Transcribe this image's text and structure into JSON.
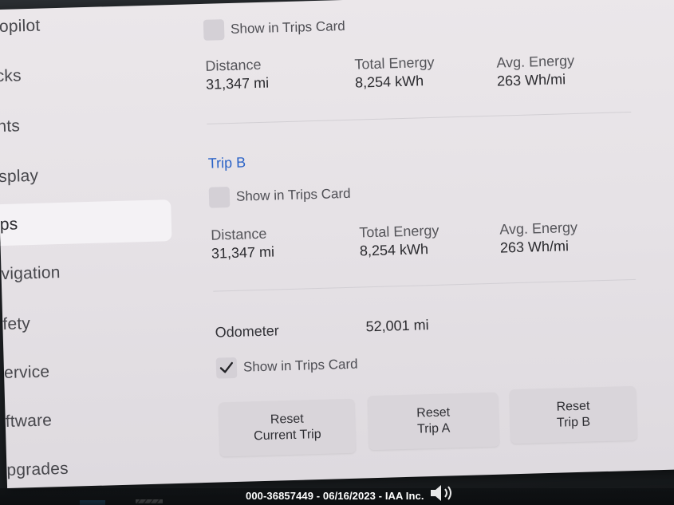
{
  "sidebar": {
    "items": [
      {
        "label": "topilot"
      },
      {
        "label": "cks"
      },
      {
        "label": "hts"
      },
      {
        "label": "splay"
      },
      {
        "label": "ps"
      },
      {
        "label": "vigation"
      },
      {
        "label": "fety"
      },
      {
        "label": "ervice"
      },
      {
        "label": "ftware"
      },
      {
        "label": "pgrades"
      }
    ],
    "active_index": 4
  },
  "trip_a": {
    "show_in_trips_card": {
      "label": "Show in Trips Card",
      "checked": false
    },
    "distance": {
      "label": "Distance",
      "value": "31,347 mi"
    },
    "total_energy": {
      "label": "Total Energy",
      "value": "8,254 kWh"
    },
    "avg_energy": {
      "label": "Avg. Energy",
      "value": "263 Wh/mi"
    }
  },
  "trip_b": {
    "title": "Trip B",
    "show_in_trips_card": {
      "label": "Show in Trips Card",
      "checked": false
    },
    "distance": {
      "label": "Distance",
      "value": "31,347 mi"
    },
    "total_energy": {
      "label": "Total Energy",
      "value": "8,254 kWh"
    },
    "avg_energy": {
      "label": "Avg. Energy",
      "value": "263 Wh/mi"
    }
  },
  "odometer": {
    "label": "Odometer",
    "value": "52,001 mi",
    "show_in_trips_card": {
      "label": "Show in Trips Card",
      "checked": true
    }
  },
  "buttons": {
    "reset_current_trip": {
      "line1": "Reset",
      "line2": "Current Trip"
    },
    "reset_trip_a": {
      "line1": "Reset",
      "line2": "Trip A"
    },
    "reset_trip_b": {
      "line1": "Reset",
      "line2": "Trip B"
    }
  },
  "watermark": "000-36857449 - 06/16/2023 - IAA Inc.",
  "icons": {
    "checkmark": "check-icon",
    "speaker": "speaker-icon"
  },
  "colors": {
    "accent_blue": "#2b63c7",
    "panel_bg": "#e6e2e6",
    "button_bg": "#d9d5da"
  }
}
